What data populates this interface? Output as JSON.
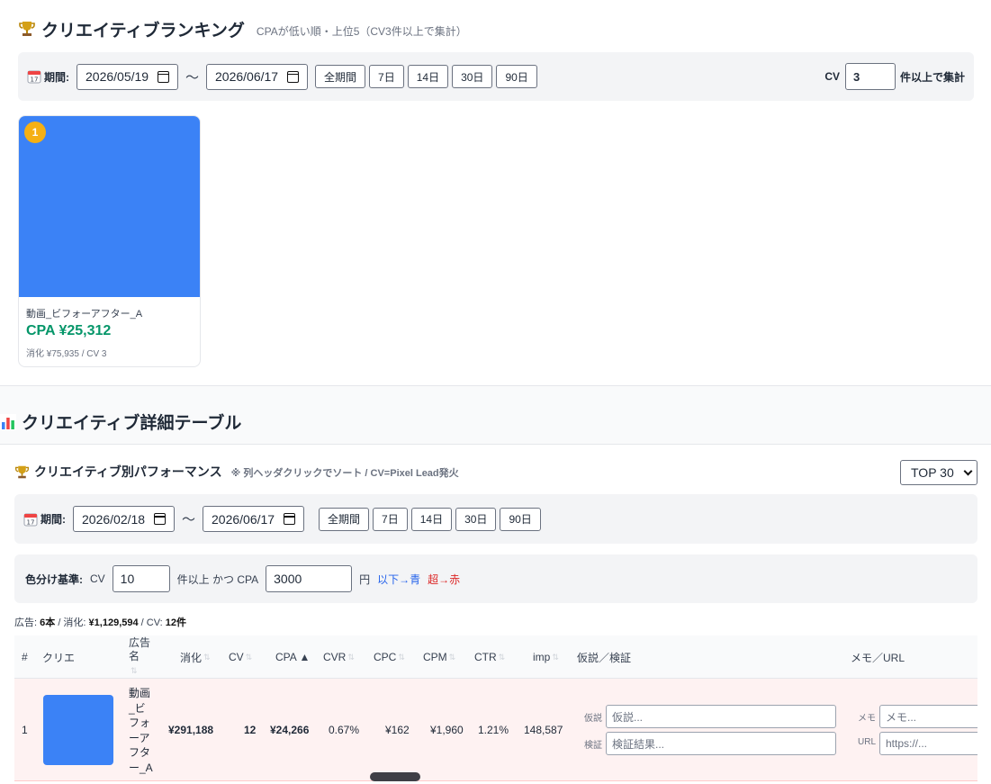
{
  "ranking": {
    "title": "クリエイティブランキング",
    "subtitle": "CPAが低い順・上位5（CV3件以上で集計）",
    "period_label": "期間:",
    "date_from": "2026/05/19",
    "date_to": "2026/06/17",
    "tilde": "〜",
    "buttons": [
      "全期間",
      "7日",
      "14日",
      "30日",
      "90日"
    ],
    "cv_label": "CV",
    "cv_value": "3",
    "cv_suffix": "件以上で集計",
    "cards": [
      {
        "rank": "1",
        "name": "動画_ビフォーアフター_A",
        "cpa": "CPA ¥25,312",
        "meta": "消化 ¥75,935 / CV 3",
        "thumb_color": "#3b82f6"
      }
    ]
  },
  "detail": {
    "heading": "クリエイティブ詳細テーブル",
    "perf_title": "クリエイティブ別パフォーマンス",
    "perf_note": "※ 列ヘッダクリックでソート / CV=Pixel Lead発火",
    "top_select": "TOP 30",
    "period_label": "期間:",
    "date_from": "2026/02/18",
    "date_to": "2026/06/17",
    "tilde": "〜",
    "buttons": [
      "全期間",
      "7日",
      "14日",
      "30日",
      "90日"
    ],
    "color_rule": {
      "label": "色分け基準:",
      "cv_label": "CV",
      "cv_value": "10",
      "mid_text": "件以上 かつ CPA",
      "cpa_value": "3000",
      "yen": "円",
      "below": "以下→青",
      "above": "超→赤"
    },
    "summary": {
      "ads_label": "広告:",
      "ads_value": "6本",
      "spend_label": "/ 消化:",
      "spend_value": "¥1,129,594",
      "cv_label": "/ CV:",
      "cv_value": "12件"
    },
    "columns": {
      "idx": "#",
      "creative": "クリエ",
      "adname": "広告名",
      "spend": "消化",
      "cv": "CV",
      "cpa": "CPA ▲",
      "cvr": "CVR",
      "cpc": "CPC",
      "cpm": "CPM",
      "ctr": "CTR",
      "imp": "imp",
      "hypo": "仮説／検証",
      "memo": "メモ／URL",
      "sort_mark": "⇅"
    },
    "rows": [
      {
        "idx": "1",
        "adname": "動画_ビフォーアフター_A",
        "spend": "¥291,188",
        "cv": "12",
        "cpa": "¥24,266",
        "cvr": "0.67%",
        "cpc": "¥162",
        "cpm": "¥1,960",
        "ctr": "1.21%",
        "imp": "148,587",
        "hypo_label": "仮説",
        "hypo_placeholder": "仮説...",
        "verify_label": "検証",
        "verify_placeholder": "検証結果...",
        "memo_label": "メモ",
        "memo_placeholder": "メモ...",
        "url_label": "URL",
        "url_placeholder": "https://..."
      }
    ]
  }
}
